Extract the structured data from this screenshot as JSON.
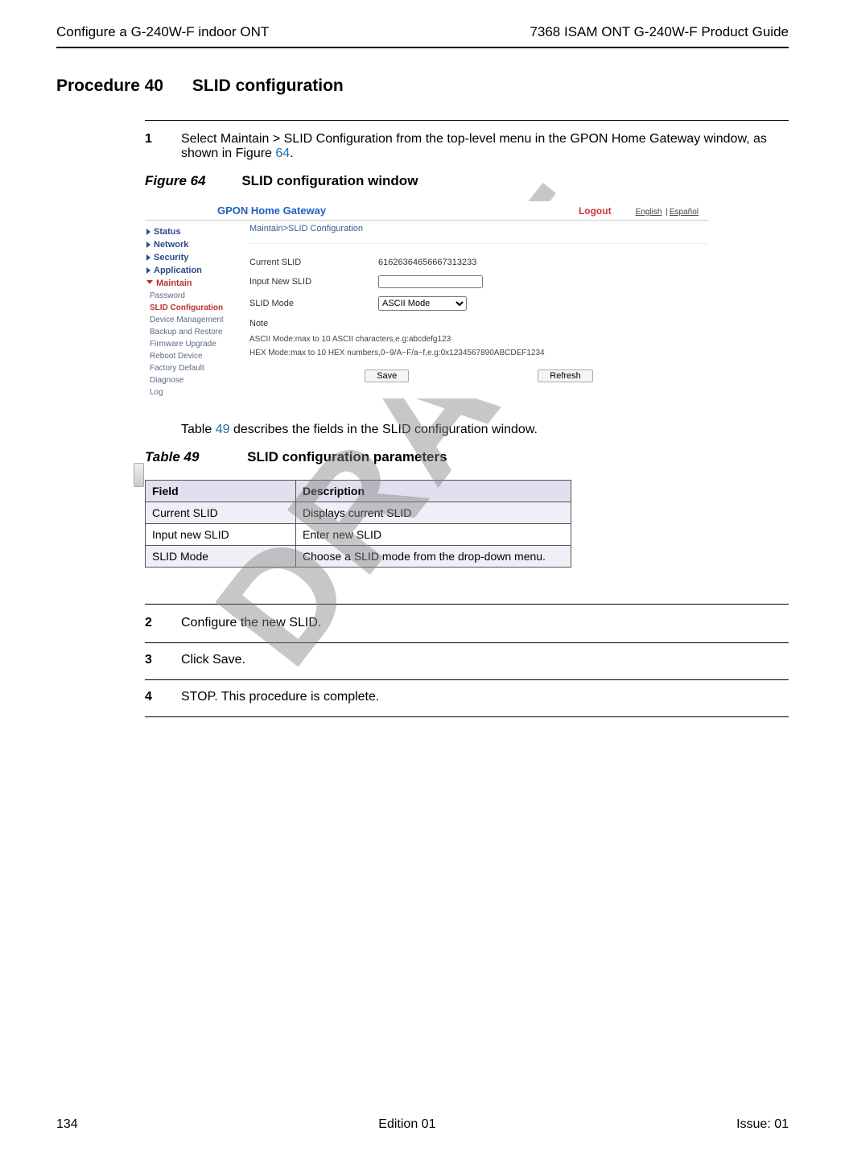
{
  "header": {
    "left": "Configure a G-240W-F indoor ONT",
    "right": "7368 ISAM ONT G-240W-F Product Guide"
  },
  "watermark": "DRAFT",
  "procedure": {
    "num": "Procedure 40",
    "title": "SLID configuration"
  },
  "step1": {
    "num": "1",
    "text_a": "Select Maintain > SLID Configuration from the top-level menu in the GPON Home Gateway window, as shown in Figure ",
    "fig_link": "64",
    "text_b": "."
  },
  "figure": {
    "label": "Figure 64",
    "title": "SLID configuration window"
  },
  "screenshot": {
    "title": "GPON Home Gateway",
    "logout": "Logout",
    "lang_en": "English",
    "lang_es": "Español",
    "side": {
      "status": "Status",
      "network": "Network",
      "security": "Security",
      "application": "Application",
      "maintain": "Maintain",
      "subs": {
        "password": "Password",
        "slid": "SLID Configuration",
        "device_mgmt": "Device Management",
        "backup": "Backup and Restore",
        "firmware": "Firmware Upgrade",
        "reboot": "Reboot Device",
        "factory": "Factory Default",
        "diagnose": "Diagnose",
        "log": "Log"
      }
    },
    "breadcrumb": "Maintain>SLID Configuration",
    "fields": {
      "current_label": "Current SLID",
      "current_value": "61626364656667313233",
      "input_label": "Input New SLID",
      "input_value": "",
      "mode_label": "SLID Mode",
      "mode_selected": "ASCII Mode",
      "note_label": "Note"
    },
    "notes": {
      "ascii": "ASCII Mode:max to 10 ASCII characters,e.g:abcdefg123",
      "hex": "HEX Mode:max to 10 HEX numbers,0~9/A~F/a~f,e.g:0x1234567890ABCDEF1234"
    },
    "buttons": {
      "save": "Save",
      "refresh": "Refresh"
    }
  },
  "table_intro_a": "Table ",
  "table_intro_link": "49",
  "table_intro_b": " describes the fields in the SLID configuration window.",
  "table": {
    "label": "Table 49",
    "title": "SLID configuration parameters",
    "headers": {
      "field": "Field",
      "desc": "Description"
    },
    "rows": [
      {
        "field": "Current SLID",
        "desc": "Displays current SLID"
      },
      {
        "field": "Input new SLID",
        "desc": "Enter new SLID"
      },
      {
        "field": "SLID Mode",
        "desc": "Choose a SLID mode from the drop-down menu."
      }
    ]
  },
  "step2": {
    "num": "2",
    "text": "Configure the new SLID."
  },
  "step3": {
    "num": "3",
    "text": "Click Save."
  },
  "step4": {
    "num": "4",
    "text": "STOP. This procedure is complete."
  },
  "footer": {
    "left": "134",
    "center": "Edition 01",
    "right": "Issue: 01"
  }
}
